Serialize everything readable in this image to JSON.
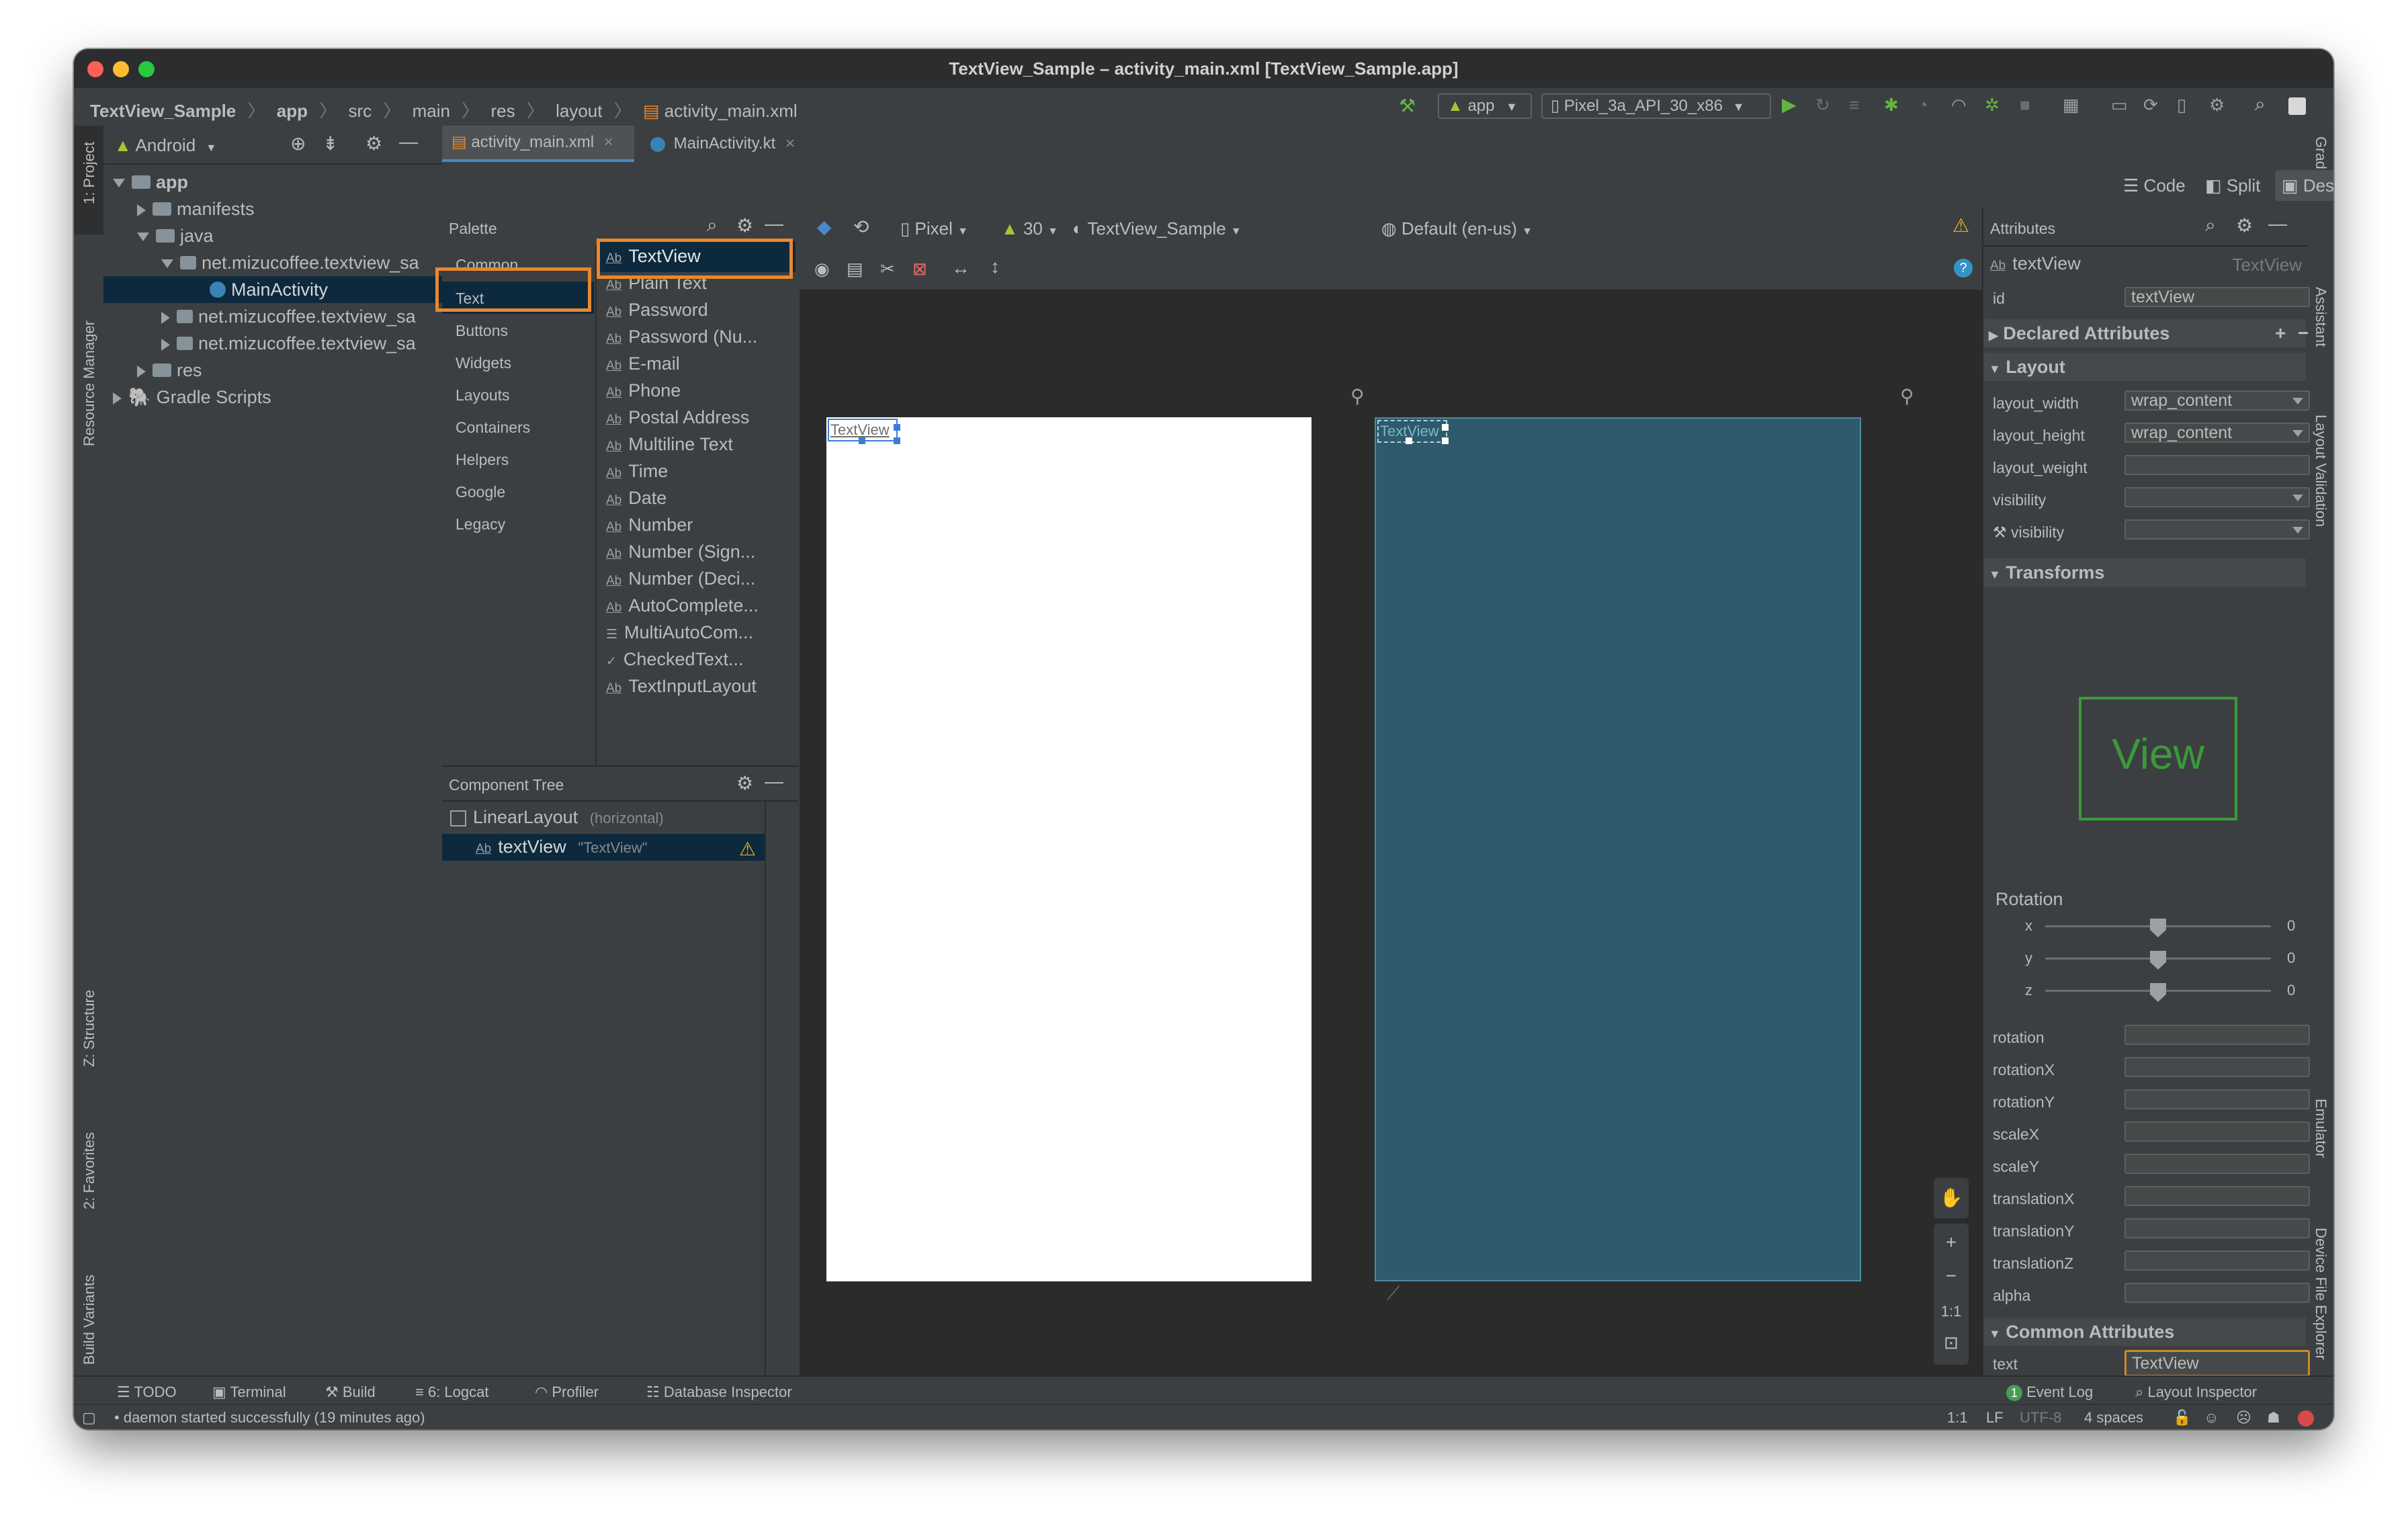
{
  "window": {
    "title": "TextView_Sample – activity_main.xml [TextView_Sample.app]"
  },
  "breadcrumb": [
    "TextView_Sample",
    "app",
    "src",
    "main",
    "res",
    "layout",
    "activity_main.xml"
  ],
  "toolbar": {
    "run_config": "app",
    "device": "Pixel_3a_API_30_x86"
  },
  "left_tool_strip": [
    "1: Project",
    "Resource Manager",
    "Z: Structure",
    "2: Favorites",
    "Build Variants"
  ],
  "right_tool_strip": [
    "Gradle",
    "Assistant",
    "Layout Validation",
    "Emulator",
    "Device File Explorer"
  ],
  "project_panel": {
    "view_selector": "Android",
    "tree": [
      {
        "label": "app",
        "depth": 0,
        "expanded": true,
        "kind": "module",
        "bold": true
      },
      {
        "label": "manifests",
        "depth": 1,
        "expanded": false,
        "kind": "folder"
      },
      {
        "label": "java",
        "depth": 1,
        "expanded": true,
        "kind": "folder"
      },
      {
        "label": "net.mizucoffee.textview_sa",
        "depth": 2,
        "expanded": true,
        "kind": "package"
      },
      {
        "label": "MainActivity",
        "depth": 3,
        "kind": "class",
        "selected": true
      },
      {
        "label": "net.mizucoffee.textview_sa",
        "depth": 2,
        "expanded": false,
        "kind": "package"
      },
      {
        "label": "net.mizucoffee.textview_sa",
        "depth": 2,
        "expanded": false,
        "kind": "package"
      },
      {
        "label": "res",
        "depth": 1,
        "expanded": false,
        "kind": "folder"
      },
      {
        "label": "Gradle Scripts",
        "depth": 0,
        "expanded": false,
        "kind": "gradle"
      }
    ]
  },
  "editor_tabs": [
    {
      "label": "activity_main.xml",
      "active": true
    },
    {
      "label": "MainActivity.kt",
      "active": false
    }
  ],
  "view_modes": {
    "code": "Code",
    "split": "Split",
    "design": "Design",
    "active": "Design"
  },
  "palette": {
    "title": "Palette",
    "categories": [
      "Common",
      "Text",
      "Buttons",
      "Widgets",
      "Layouts",
      "Containers",
      "Helpers",
      "Google",
      "Legacy"
    ],
    "selected_category": "Text",
    "items": [
      "TextView",
      "Plain Text",
      "Password",
      "Password (Nu...",
      "E-mail",
      "Phone",
      "Postal Address",
      "Multiline Text",
      "Time",
      "Date",
      "Number",
      "Number (Sign...",
      "Number (Deci...",
      "AutoComplete...",
      "MultiAutoCom...",
      "CheckedText...",
      "TextInputLayout"
    ],
    "selected_item": "TextView"
  },
  "design_toolbar": {
    "device": "Pixel",
    "api": "30",
    "theme": "TextView_Sample",
    "locale": "Default (en-us)"
  },
  "component_tree": {
    "title": "Component Tree",
    "rows": [
      {
        "name": "LinearLayout",
        "detail": "(horizontal)"
      },
      {
        "name": "textView",
        "detail": "\"TextView\"",
        "warning": true
      }
    ]
  },
  "canvas": {
    "design_label": "TextView",
    "blueprint_label": "TextView",
    "zoom_reset": "1:1"
  },
  "attributes": {
    "title": "Attributes",
    "component_name": "textView",
    "component_type": "TextView",
    "id_label": "id",
    "id_value": "textView",
    "sections": {
      "declared": "Declared Attributes",
      "layout": "Layout",
      "transforms": "Transforms",
      "common": "Common Attributes"
    },
    "layout_rows": [
      {
        "label": "layout_width",
        "value": "wrap_content",
        "dropdown": true
      },
      {
        "label": "layout_height",
        "value": "wrap_content",
        "dropdown": true
      },
      {
        "label": "layout_weight",
        "value": "",
        "dropdown": false
      },
      {
        "label": "visibility",
        "value": "",
        "dropdown": true
      },
      {
        "label": "visibility",
        "value": "",
        "dropdown": true,
        "tool": true
      }
    ],
    "view_preview": "View",
    "rotation": {
      "title": "Rotation",
      "sliders": [
        {
          "axis": "x",
          "value": "0"
        },
        {
          "axis": "y",
          "value": "0"
        },
        {
          "axis": "z",
          "value": "0"
        }
      ]
    },
    "transform_rows": [
      "rotation",
      "rotationX",
      "rotationY",
      "scaleX",
      "scaleY",
      "translationX",
      "translationY",
      "translationZ",
      "alpha"
    ],
    "text_label": "text",
    "text_value": "TextView"
  },
  "bottom_tools": {
    "left": [
      "TODO",
      "Terminal",
      "Build",
      "6: Logcat",
      "Profiler",
      "Database Inspector"
    ],
    "right": [
      "Event Log",
      "Layout Inspector"
    ],
    "event_badge": "1"
  },
  "status": {
    "message": "daemon started successfully (19 minutes ago)",
    "position": "1:1",
    "line_sep": "LF",
    "encoding": "UTF-8",
    "indent": "4 spaces"
  },
  "colors": {
    "accent_orange": "#e8882e",
    "selection_blue": "#0d293e",
    "blueprint": "#2f5a6b",
    "android_green": "#a4c639"
  }
}
